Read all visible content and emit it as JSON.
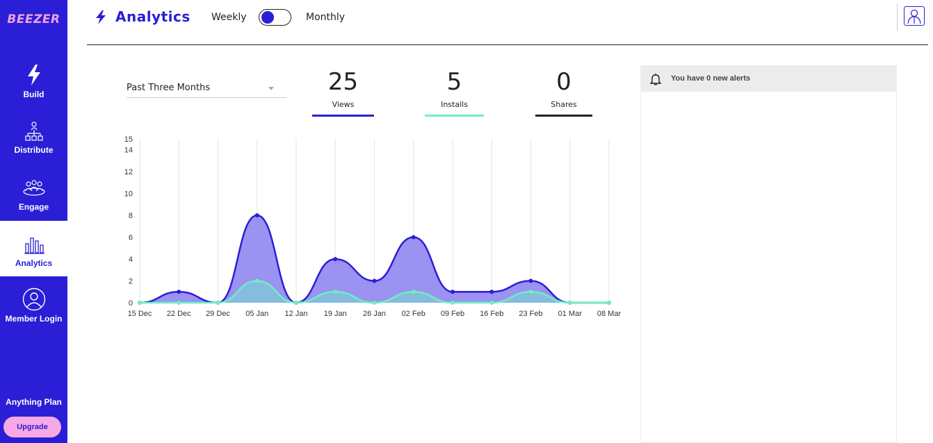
{
  "brand": {
    "logo_text": "BEEZER",
    "accent": "#2a1ed6",
    "pink": "#f6a9e4"
  },
  "sidebar": {
    "items": [
      {
        "label": "Build",
        "icon": "bolt-icon",
        "active": false
      },
      {
        "label": "Distribute",
        "icon": "org-chart-icon",
        "active": false
      },
      {
        "label": "Engage",
        "icon": "group-icon",
        "active": false
      },
      {
        "label": "Analytics",
        "icon": "bar-chart-icon",
        "active": true
      },
      {
        "label": "Member Login",
        "icon": "user-circle-icon",
        "active": false
      }
    ],
    "plan_name": "Anything Plan",
    "upgrade_label": "Upgrade"
  },
  "header": {
    "title": "Analytics",
    "toggle_left": "Weekly",
    "toggle_right": "Monthly",
    "toggle_state": "Weekly"
  },
  "filter": {
    "period": "Past Three Months"
  },
  "stats": [
    {
      "value": "25",
      "label": "Views",
      "color": "#2a1ed6"
    },
    {
      "value": "5",
      "label": "Installs",
      "color": "#6df0bf"
    },
    {
      "value": "0",
      "label": "Shares",
      "color": "#222222"
    }
  ],
  "alerts": {
    "message": "You have 0 new alerts"
  },
  "chart_data": {
    "type": "area",
    "categories": [
      "15 Dec",
      "22 Dec",
      "29 Dec",
      "05 Jan",
      "12 Jan",
      "19 Jan",
      "26 Jan",
      "02 Feb",
      "09 Feb",
      "16 Feb",
      "23 Feb",
      "01 Mar",
      "08 Mar"
    ],
    "series": [
      {
        "name": "Views",
        "color": "#2a1ed6",
        "fill": "#8a7ff0",
        "values": [
          0,
          1,
          0,
          8,
          0,
          4,
          2,
          6,
          1,
          1,
          2,
          0,
          0
        ]
      },
      {
        "name": "Installs",
        "color": "#6df0bf",
        "fill": "#7fc9d8",
        "values": [
          0,
          0,
          0,
          2,
          0,
          1,
          0,
          1,
          0,
          0,
          1,
          0,
          0
        ]
      }
    ],
    "yticks": [
      0,
      2,
      4,
      6,
      8,
      10,
      12,
      14,
      15
    ],
    "ylim": [
      0,
      15
    ],
    "grid": true
  }
}
